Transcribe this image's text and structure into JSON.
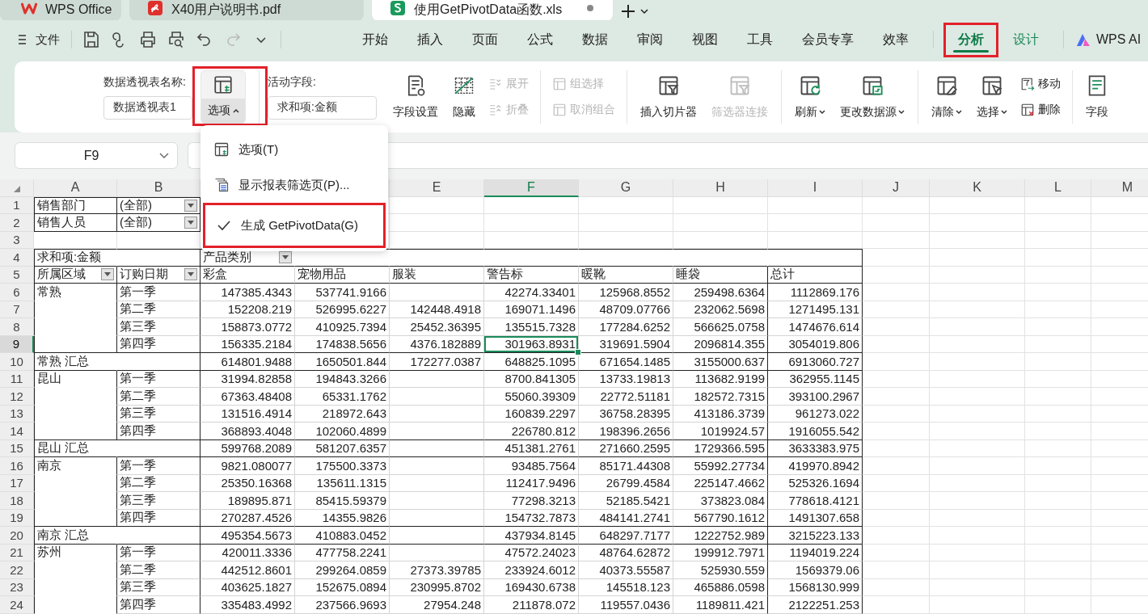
{
  "tabs": [
    {
      "label": "WPS Office",
      "kind": "wps",
      "selected": false,
      "modified": false
    },
    {
      "label": "X40用户说明书.pdf",
      "kind": "pdf",
      "selected": false,
      "modified": false
    },
    {
      "label": "使用GetPivotData函数.xls",
      "kind": "sheet",
      "selected": true,
      "modified": true
    }
  ],
  "file_menu": {
    "label": "文件"
  },
  "menu_tabs": [
    {
      "label": "开始",
      "selected": false,
      "highlighted": false,
      "contextual": false
    },
    {
      "label": "插入",
      "selected": false,
      "highlighted": false,
      "contextual": false
    },
    {
      "label": "页面",
      "selected": false,
      "highlighted": false,
      "contextual": false
    },
    {
      "label": "公式",
      "selected": false,
      "highlighted": false,
      "contextual": false
    },
    {
      "label": "数据",
      "selected": false,
      "highlighted": false,
      "contextual": false
    },
    {
      "label": "审阅",
      "selected": false,
      "highlighted": false,
      "contextual": false
    },
    {
      "label": "视图",
      "selected": false,
      "highlighted": false,
      "contextual": false
    },
    {
      "label": "工具",
      "selected": false,
      "highlighted": false,
      "contextual": false
    },
    {
      "label": "会员专享",
      "selected": false,
      "highlighted": false,
      "contextual": false
    },
    {
      "label": "效率",
      "selected": false,
      "highlighted": false,
      "contextual": false
    },
    {
      "label": "分析",
      "selected": true,
      "highlighted": true,
      "contextual": true
    },
    {
      "label": "设计",
      "selected": false,
      "highlighted": false,
      "contextual": true
    }
  ],
  "ai_button": {
    "label": "WPS AI"
  },
  "ribbon": {
    "pivot_name": {
      "label": "数据透视表名称:",
      "value": "数据透视表1"
    },
    "options_button": {
      "label": "选项",
      "expanded": true,
      "highlighted": true
    },
    "active_field": {
      "label": "活动字段:",
      "value": "求和项:金额"
    },
    "groups": [
      [
        {
          "label": "字段设置",
          "kind": "large",
          "disabled": false,
          "dropdown": false
        },
        {
          "label": "隐藏",
          "kind": "large",
          "disabled": false,
          "dropdown": false
        },
        {
          "label": "展开",
          "kind": "small",
          "disabled": true,
          "dropdown": false
        },
        {
          "label": "折叠",
          "kind": "small",
          "disabled": true,
          "dropdown": false
        }
      ],
      [
        {
          "label": "组选择",
          "kind": "small",
          "disabled": true,
          "dropdown": false
        },
        {
          "label": "取消组合",
          "kind": "small",
          "disabled": true,
          "dropdown": false
        }
      ],
      [
        {
          "label": "插入切片器",
          "kind": "large",
          "disabled": false,
          "dropdown": false
        },
        {
          "label": "筛选器连接",
          "kind": "large",
          "disabled": true,
          "dropdown": false
        }
      ],
      [
        {
          "label": "刷新",
          "kind": "large",
          "disabled": false,
          "dropdown": true
        },
        {
          "label": "更改数据源",
          "kind": "large",
          "disabled": false,
          "dropdown": true
        }
      ],
      [
        {
          "label": "清除",
          "kind": "large",
          "disabled": false,
          "dropdown": true
        },
        {
          "label": "选择",
          "kind": "large",
          "disabled": false,
          "dropdown": true
        },
        {
          "label": "移动",
          "kind": "small",
          "disabled": false,
          "dropdown": false
        },
        {
          "label": "删除",
          "kind": "small",
          "disabled": false,
          "dropdown": false
        }
      ],
      [
        {
          "label": "字段",
          "kind": "large",
          "disabled": false,
          "dropdown": false
        }
      ]
    ]
  },
  "formula_bar": {
    "name_box": "F9"
  },
  "options_menu": {
    "items": [
      {
        "label": "选项(T)",
        "checked": false,
        "highlighted": false
      },
      {
        "label": "显示报表筛选页(P)...",
        "checked": false,
        "highlighted": false
      },
      {
        "label": "生成 GetPivotData(G)",
        "checked": true,
        "highlighted": true
      }
    ]
  },
  "sheet": {
    "columns": [
      {
        "letter": "A",
        "selected": false
      },
      {
        "letter": "B",
        "selected": false
      },
      {},
      {},
      {
        "letter": "E",
        "selected": false
      },
      {
        "letter": "F",
        "selected": true
      },
      {
        "letter": "G",
        "selected": false
      },
      {
        "letter": "H",
        "selected": false
      },
      {
        "letter": "I",
        "selected": false
      },
      {
        "letter": "J",
        "selected": false
      },
      {
        "letter": "K",
        "selected": false
      },
      {
        "letter": "L",
        "selected": false
      },
      {
        "letter": "M",
        "selected": false
      }
    ],
    "rows": [
      {
        "number": "1",
        "selected": false,
        "kind": "filter",
        "cells": [
          {
            "text": "销售部门"
          },
          {
            "text": "(全部)",
            "filter": true
          }
        ]
      },
      {
        "number": "2",
        "selected": false,
        "kind": "filter",
        "cells": [
          {
            "text": "销售人员"
          },
          {
            "text": "(全部)",
            "filter": true
          }
        ]
      },
      {
        "number": "3",
        "selected": false,
        "kind": "blank"
      },
      {
        "number": "4",
        "selected": false,
        "kind": "pivot_head",
        "cells": [
          {
            "text": "求和项:金额"
          },
          {},
          {
            "text": "产品类别",
            "filter": true
          }
        ]
      },
      {
        "number": "5",
        "selected": false,
        "kind": "header",
        "cells": [
          {
            "text": "所属区域",
            "filter": true
          },
          {
            "text": "订购日期",
            "filter": true
          },
          {
            "text": "彩盒"
          },
          {
            "text": "宠物用品"
          },
          {
            "text": "服装"
          },
          {
            "text": "警告标"
          },
          {
            "text": "暖靴"
          },
          {
            "text": "睡袋"
          },
          {
            "text": "总计"
          }
        ]
      },
      {
        "number": "6",
        "selected": false,
        "kind": "data",
        "cells": [
          {
            "text": "常熟"
          },
          {
            "text": "第一季"
          },
          {
            "text": "147385.4343"
          },
          {
            "text": "537741.9166"
          },
          {},
          {
            "text": "42274.33401"
          },
          {
            "text": "125968.8552"
          },
          {
            "text": "259498.6364"
          },
          {
            "text": "1112869.176"
          }
        ]
      },
      {
        "number": "7",
        "selected": false,
        "kind": "data",
        "cells": [
          {},
          {
            "text": "第二季"
          },
          {
            "text": "152208.219"
          },
          {
            "text": "526995.6227"
          },
          {
            "text": "142448.4918"
          },
          {
            "text": "169071.1496"
          },
          {
            "text": "48709.07766"
          },
          {
            "text": "232062.5698"
          },
          {
            "text": "1271495.131"
          }
        ]
      },
      {
        "number": "8",
        "selected": false,
        "kind": "data",
        "cells": [
          {},
          {
            "text": "第三季"
          },
          {
            "text": "158873.0772"
          },
          {
            "text": "410925.7394"
          },
          {
            "text": "25452.36395"
          },
          {
            "text": "135515.7328"
          },
          {
            "text": "177284.6252"
          },
          {
            "text": "566625.0758"
          },
          {
            "text": "1474676.614"
          }
        ]
      },
      {
        "number": "9",
        "selected": true,
        "kind": "data",
        "cells": [
          {},
          {
            "text": "第四季"
          },
          {
            "text": "156335.2184"
          },
          {
            "text": "174838.5656"
          },
          {
            "text": "4376.182889"
          },
          {
            "text": "301963.8931"
          },
          {
            "text": "319691.5904"
          },
          {
            "text": "2096814.355"
          },
          {
            "text": "3054019.806"
          }
        ]
      },
      {
        "number": "10",
        "selected": false,
        "kind": "subtotal",
        "cells": [
          {
            "text": "常熟 汇总"
          },
          {},
          {
            "text": "614801.9488"
          },
          {
            "text": "1650501.844"
          },
          {
            "text": "172277.0387"
          },
          {
            "text": "648825.1095"
          },
          {
            "text": "671654.1485"
          },
          {
            "text": "3155000.637"
          },
          {
            "text": "6913060.727"
          }
        ]
      },
      {
        "number": "11",
        "selected": false,
        "kind": "data",
        "cells": [
          {
            "text": "昆山"
          },
          {
            "text": "第一季"
          },
          {
            "text": "31994.82858"
          },
          {
            "text": "194843.3266"
          },
          {},
          {
            "text": "8700.841305"
          },
          {
            "text": "13733.19813"
          },
          {
            "text": "113682.9199"
          },
          {
            "text": "362955.1145"
          }
        ]
      },
      {
        "number": "12",
        "selected": false,
        "kind": "data",
        "cells": [
          {},
          {
            "text": "第二季"
          },
          {
            "text": "67363.48408"
          },
          {
            "text": "65331.1762"
          },
          {},
          {
            "text": "55060.39309"
          },
          {
            "text": "22772.51181"
          },
          {
            "text": "182572.7315"
          },
          {
            "text": "393100.2967"
          }
        ]
      },
      {
        "number": "13",
        "selected": false,
        "kind": "data",
        "cells": [
          {},
          {
            "text": "第三季"
          },
          {
            "text": "131516.4914"
          },
          {
            "text": "218972.643"
          },
          {},
          {
            "text": "160839.2297"
          },
          {
            "text": "36758.28395"
          },
          {
            "text": "413186.3739"
          },
          {
            "text": "961273.022"
          }
        ]
      },
      {
        "number": "14",
        "selected": false,
        "kind": "data",
        "cells": [
          {},
          {
            "text": "第四季"
          },
          {
            "text": "368893.4048"
          },
          {
            "text": "102060.4899"
          },
          {},
          {
            "text": "226780.812"
          },
          {
            "text": "198396.2656"
          },
          {
            "text": "1019924.57"
          },
          {
            "text": "1916055.542"
          }
        ]
      },
      {
        "number": "15",
        "selected": false,
        "kind": "subtotal",
        "cells": [
          {
            "text": "昆山 汇总"
          },
          {},
          {
            "text": "599768.2089"
          },
          {
            "text": "581207.6357"
          },
          {},
          {
            "text": "451381.2761"
          },
          {
            "text": "271660.2595"
          },
          {
            "text": "1729366.595"
          },
          {
            "text": "3633383.975"
          }
        ]
      },
      {
        "number": "16",
        "selected": false,
        "kind": "data",
        "cells": [
          {
            "text": "南京"
          },
          {
            "text": "第一季"
          },
          {
            "text": "9821.080077"
          },
          {
            "text": "175500.3373"
          },
          {},
          {
            "text": "93485.7564"
          },
          {
            "text": "85171.44308"
          },
          {
            "text": "55992.27734"
          },
          {
            "text": "419970.8942"
          }
        ]
      },
      {
        "number": "17",
        "selected": false,
        "kind": "data",
        "cells": [
          {},
          {
            "text": "第二季"
          },
          {
            "text": "25350.16368"
          },
          {
            "text": "135611.1315"
          },
          {},
          {
            "text": "112417.9496"
          },
          {
            "text": "26799.4584"
          },
          {
            "text": "225147.4662"
          },
          {
            "text": "525326.1694"
          }
        ]
      },
      {
        "number": "18",
        "selected": false,
        "kind": "data",
        "cells": [
          {},
          {
            "text": "第三季"
          },
          {
            "text": "189895.871"
          },
          {
            "text": "85415.59379"
          },
          {},
          {
            "text": "77298.3213"
          },
          {
            "text": "52185.5421"
          },
          {
            "text": "373823.084"
          },
          {
            "text": "778618.4121"
          }
        ]
      },
      {
        "number": "19",
        "selected": false,
        "kind": "data",
        "cells": [
          {},
          {
            "text": "第四季"
          },
          {
            "text": "270287.4526"
          },
          {
            "text": "14355.9826"
          },
          {},
          {
            "text": "154732.7873"
          },
          {
            "text": "484141.2741"
          },
          {
            "text": "567790.1612"
          },
          {
            "text": "1491307.658"
          }
        ]
      },
      {
        "number": "20",
        "selected": false,
        "kind": "subtotal",
        "cells": [
          {
            "text": "南京 汇总"
          },
          {},
          {
            "text": "495354.5673"
          },
          {
            "text": "410883.0452"
          },
          {},
          {
            "text": "437934.8145"
          },
          {
            "text": "648297.7177"
          },
          {
            "text": "1222752.989"
          },
          {
            "text": "3215223.133"
          }
        ]
      },
      {
        "number": "21",
        "selected": false,
        "kind": "data",
        "cells": [
          {
            "text": "苏州"
          },
          {
            "text": "第一季"
          },
          {
            "text": "420011.3336"
          },
          {
            "text": "477758.2241"
          },
          {},
          {
            "text": "47572.24023"
          },
          {
            "text": "48764.62872"
          },
          {
            "text": "199912.7971"
          },
          {
            "text": "1194019.224"
          }
        ]
      },
      {
        "number": "22",
        "selected": false,
        "kind": "data",
        "cells": [
          {},
          {
            "text": "第二季"
          },
          {
            "text": "442512.8601"
          },
          {
            "text": "299264.0859"
          },
          {
            "text": "27373.39785"
          },
          {
            "text": "233924.6012"
          },
          {
            "text": "40373.55587"
          },
          {
            "text": "525930.559"
          },
          {
            "text": "1569379.06"
          }
        ]
      },
      {
        "number": "23",
        "selected": false,
        "kind": "data",
        "cells": [
          {},
          {
            "text": "第三季"
          },
          {
            "text": "403625.1827"
          },
          {
            "text": "152675.0894"
          },
          {
            "text": "230995.8702"
          },
          {
            "text": "169430.6738"
          },
          {
            "text": "145518.123"
          },
          {
            "text": "465886.0598"
          },
          {
            "text": "1568130.999"
          }
        ]
      },
      {
        "number": "24",
        "selected": false,
        "kind": "data",
        "cells": [
          {},
          {
            "text": "第四季"
          },
          {
            "text": "335483.4992"
          },
          {
            "text": "237566.9693"
          },
          {
            "text": "27954.248"
          },
          {
            "text": "211878.072"
          },
          {
            "text": "119557.0436"
          },
          {
            "text": "1189811.421"
          },
          {
            "text": "2122251.253"
          }
        ]
      }
    ]
  }
}
